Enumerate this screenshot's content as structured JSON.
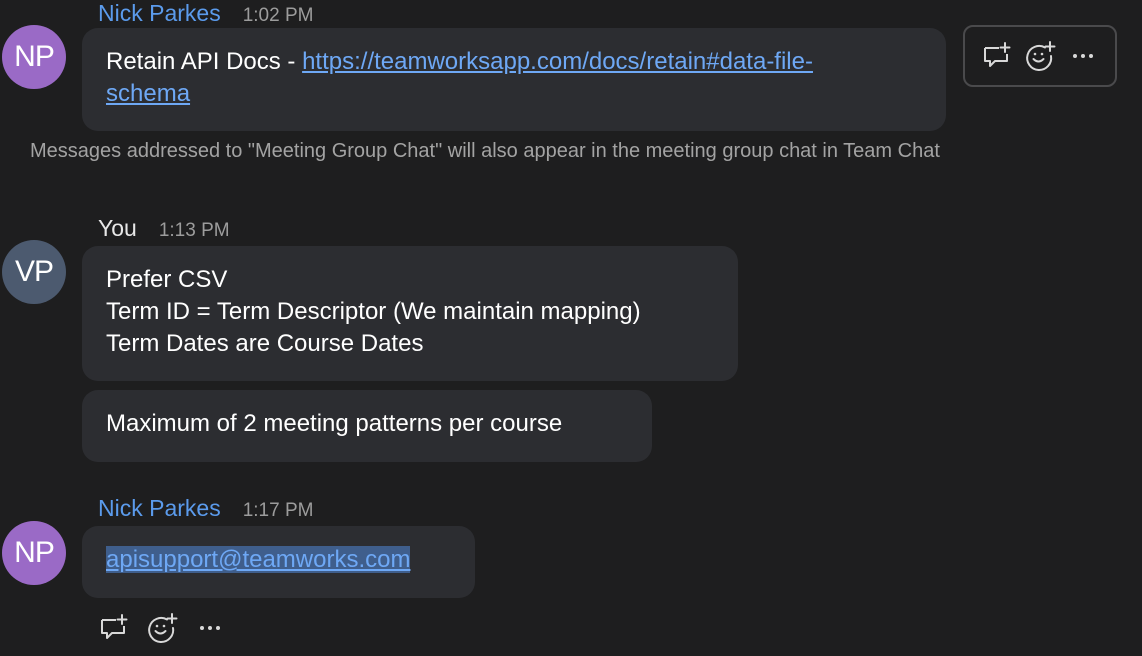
{
  "messages": [
    {
      "initials": "NP",
      "sender": "Nick Parkes",
      "time": "1:02 PM",
      "text_prefix": "Retain API Docs - ",
      "link_line1": "https://teamworksapp.com/docs/retain#data-file-",
      "link_line2": "schema"
    },
    {
      "initials": "VP",
      "sender": "You",
      "time": "1:13 PM",
      "lines": [
        "Prefer CSV",
        "Term ID = Term Descriptor (We maintain mapping)",
        "Term Dates are Course Dates"
      ],
      "second_bubble": "Maximum of 2 meeting patterns per course"
    },
    {
      "initials": "NP",
      "sender": "Nick Parkes",
      "time": "1:17 PM",
      "email": "apisupport@teamworks.com"
    }
  ],
  "system_note": "Messages addressed to \"Meeting Group Chat\" will also appear in the meeting group chat in Team Chat",
  "toolbar_icons": [
    "reply-thread-icon",
    "add-reaction-icon",
    "more-options-icon"
  ],
  "colors": {
    "background": "#1e1e1f",
    "bubble": "#2c2d31",
    "name_blue": "#5b9bec",
    "link": "#6ea8f5",
    "avatar_np": "#9a6ac6",
    "avatar_vp": "#4c5a6f"
  }
}
